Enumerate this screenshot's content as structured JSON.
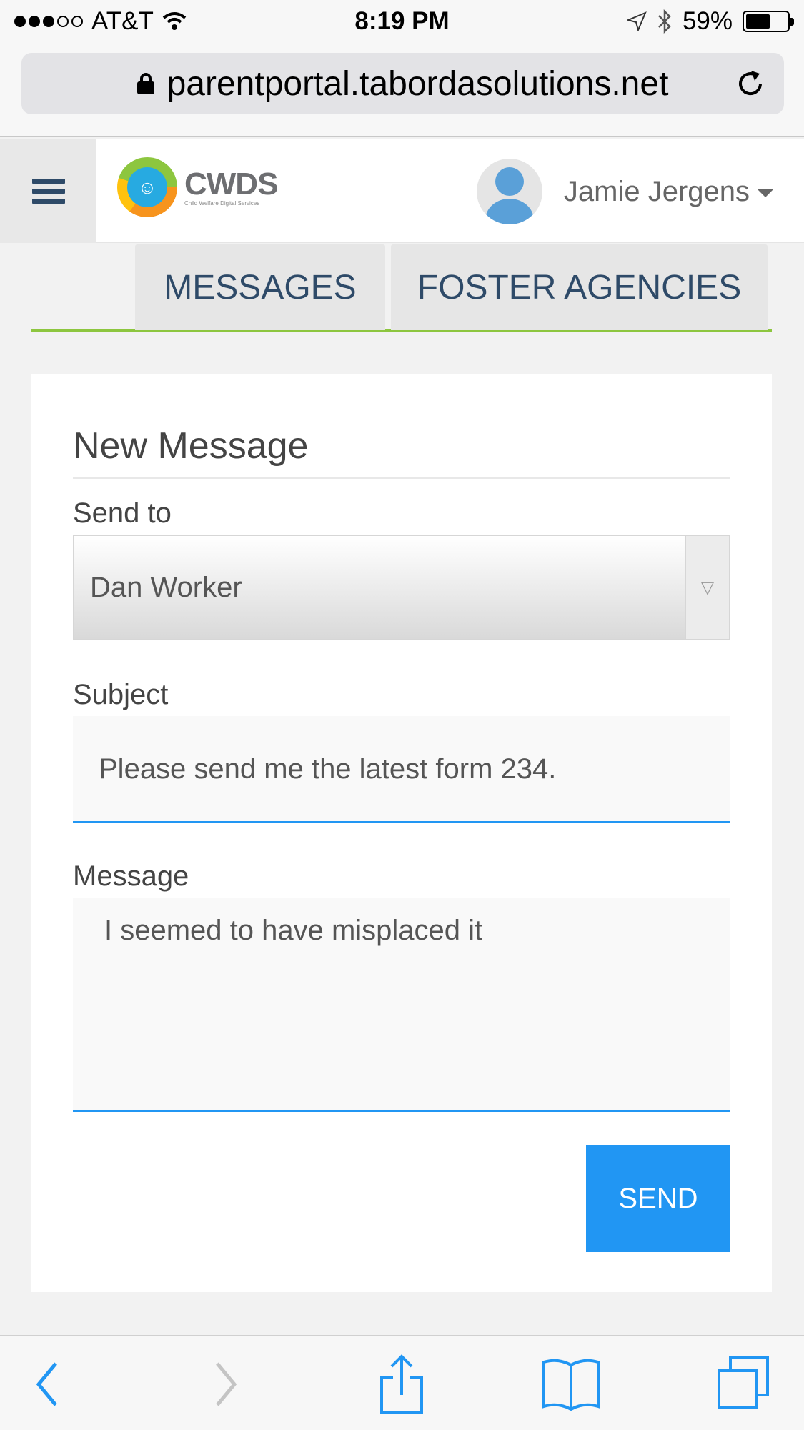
{
  "status_bar": {
    "carrier": "AT&T",
    "time": "8:19 PM",
    "battery": "59%",
    "battery_level": 0.59
  },
  "browser": {
    "url": "parentportal.tabordasolutions.net"
  },
  "header": {
    "logo_title": "CWDS",
    "logo_subtitle": "Child Welfare Digital Services",
    "user_name": "Jamie Jergens"
  },
  "tabs": [
    {
      "label": "MESSAGES"
    },
    {
      "label": "FOSTER AGENCIES"
    }
  ],
  "form": {
    "title": "New Message",
    "send_to_label": "Send to",
    "send_to_value": "Dan Worker",
    "subject_label": "Subject",
    "subject_value": "Please send me the latest form 234.",
    "message_label": "Message",
    "message_value": "I seemed to have misplaced it",
    "send_label": "SEND"
  },
  "colors": {
    "accent": "#2196f3",
    "nav_text": "#2e4a68",
    "tab_underline": "#8dc63f"
  }
}
